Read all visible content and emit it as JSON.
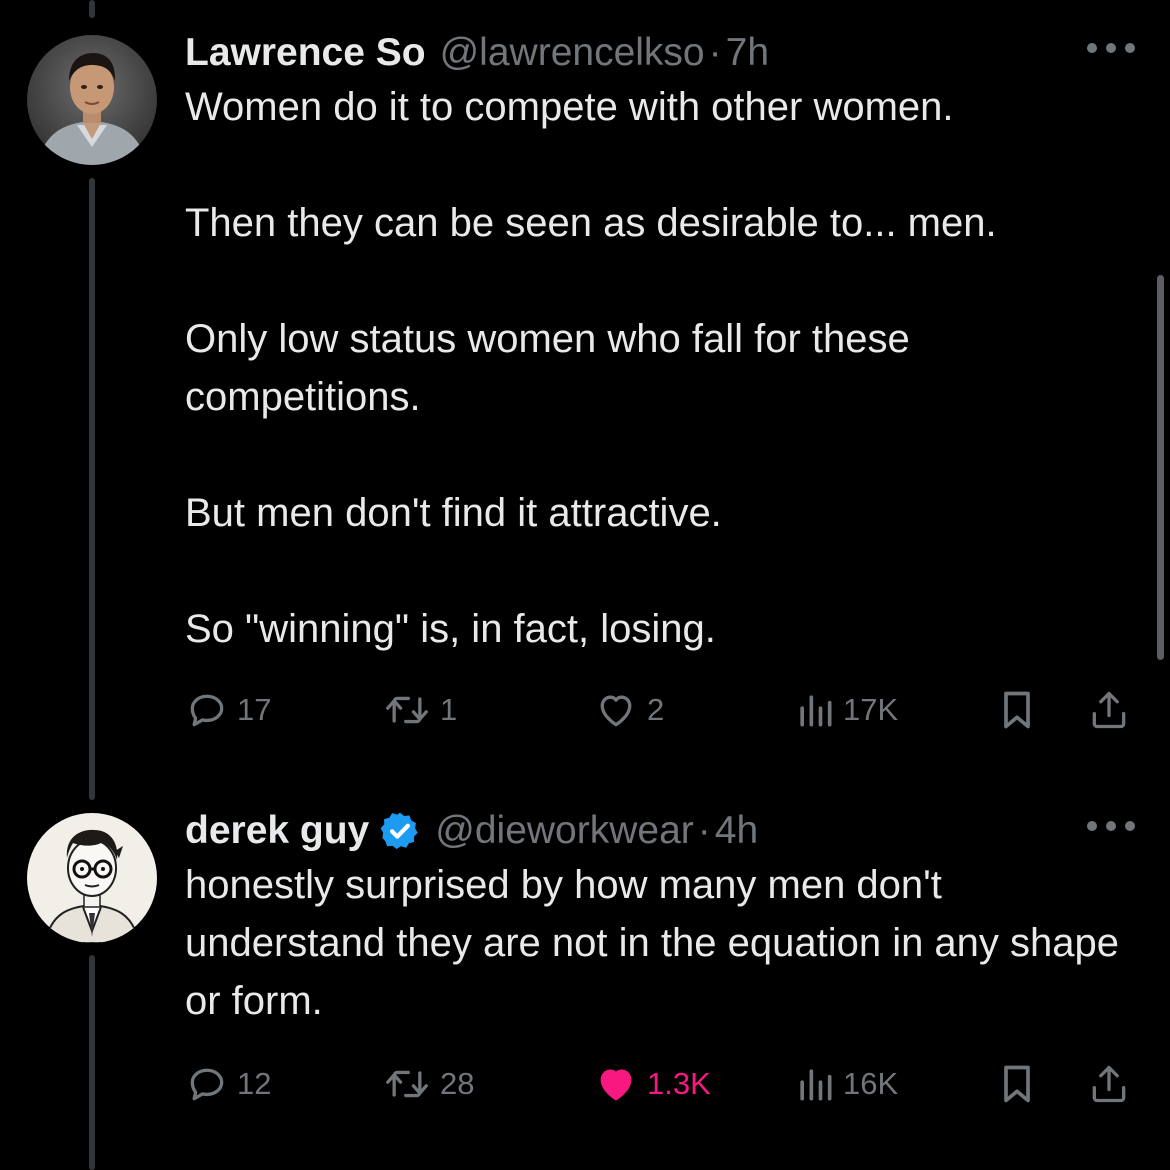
{
  "tweets": [
    {
      "author": "Lawrence So",
      "handle": "@lawrencelkso",
      "separator": "·",
      "time": "7h",
      "paragraphs": [
        "Women do it to compete with other women.",
        "Then they can be seen as desirable to... men.",
        "Only low status women who fall for these competitions.",
        "But men don't find it attractive.",
        "So \"winning\" is, in fact, losing."
      ],
      "replies": "17",
      "reposts": "1",
      "likes": "2",
      "views": "17K",
      "liked": false
    },
    {
      "author": "derek guy",
      "handle": "@dieworkwear",
      "separator": "·",
      "time": "4h",
      "verified": true,
      "paragraphs": [
        "honestly surprised by how many men don't understand they are not in the equation in any shape or form."
      ],
      "replies": "12",
      "reposts": "28",
      "likes": "1.3K",
      "views": "16K",
      "liked": true
    }
  ],
  "colors": {
    "background": "#000000",
    "text": "#e7e9ea",
    "muted": "#71767b",
    "like_active": "#f91880",
    "verified": "#1d9bf0",
    "thread_line": "#333639"
  },
  "icons": [
    "reply-icon",
    "repost-icon",
    "like-icon",
    "views-icon",
    "bookmark-icon",
    "share-icon",
    "more-icon",
    "verified-badge-icon"
  ]
}
